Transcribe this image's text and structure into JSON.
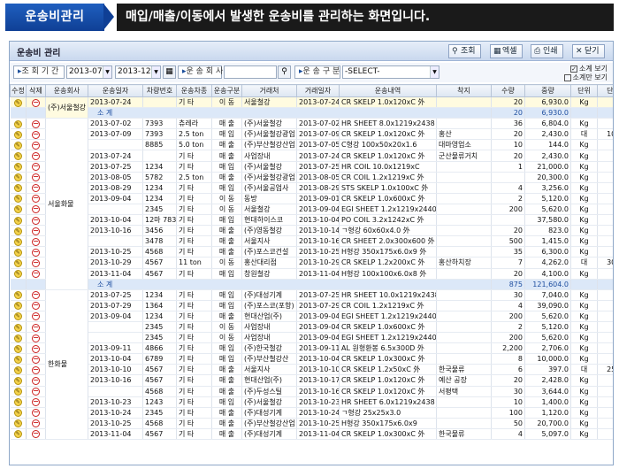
{
  "banner": {
    "title": "운송비관리",
    "description": "매입/매출/이동에서 발생한 운송비를 관리하는 화면입니다."
  },
  "window": {
    "title": "운송비 관리",
    "toolbar": {
      "search_label": "조회",
      "excel_label": "엑셀",
      "print_label": "인쇄",
      "close_label": "닫기"
    }
  },
  "filter": {
    "period_label": "조 회 기 간",
    "date_from": "2013-07-01",
    "date_to": "2013-12-31",
    "company_label": "운 송 회 사",
    "company_value": "",
    "type_label": "운 송 구 분",
    "type_value": "-SELECT-",
    "subtotal_check_label": "소계 보기",
    "subtotal_checked": true,
    "subtotal_only_label": "소계만 보기",
    "subtotal_only_checked": false
  },
  "columns": [
    "수정",
    "삭제",
    "운송회사",
    "운송일자",
    "차량번호",
    "운송차종",
    "운송구분",
    "거래처",
    "거래일자",
    "운송내역",
    "착지",
    "수량",
    "중량",
    "단위",
    "단가"
  ],
  "groups": [
    {
      "company": "(주)서울철강",
      "rows": [
        {
          "date": "2013-07-24",
          "vehicle": "",
          "car_type": "기 타",
          "kind": "이 동",
          "customer": "서울철강",
          "tx_date": "2013-07-24",
          "detail": "CR SKELP 1.0x120xC 外",
          "dest": "",
          "qty": "20",
          "weight": "6,930.0",
          "unit": "Kg",
          "price": "",
          "selected": true
        }
      ],
      "subtotal": {
        "label": "소 계",
        "qty": "20",
        "weight": "6,930.0"
      }
    },
    {
      "company": "서울화물",
      "rows": [
        {
          "date": "2013-07-02",
          "vehicle": "7393",
          "car_type": "츄레라",
          "kind": "매 출",
          "customer": "(주)서울철강",
          "tx_date": "2013-07-02",
          "detail": "HR SHEET 8.0x1219x2438 外",
          "dest": "",
          "qty": "36",
          "weight": "6,804.0",
          "unit": "Kg",
          "price": ""
        },
        {
          "date": "2013-07-09",
          "vehicle": "7393",
          "car_type": "2.5 ton",
          "kind": "매 입",
          "customer": "(주)서울철강광업",
          "tx_date": "2013-07-09",
          "detail": "CR SKELP 1.0x120xC 外",
          "dest": "홍산",
          "qty": "20",
          "weight": "2,430.0",
          "unit": "대",
          "price": "100,0"
        },
        {
          "date": "",
          "vehicle": "8885",
          "car_type": "5.0 ton",
          "kind": "매 출",
          "customer": "(주)부산철강산업",
          "tx_date": "2013-07-05",
          "detail": "C형강 100x50x20x1.6",
          "dest": "대마영업소",
          "qty": "10",
          "weight": "144.0",
          "unit": "Kg",
          "price": ""
        },
        {
          "date": "2013-07-24",
          "vehicle": "",
          "car_type": "기 타",
          "kind": "매 출",
          "customer": "사업장내",
          "tx_date": "2013-07-24",
          "detail": "CR SKELP 1.0x120xC 外",
          "dest": "군산물류거치",
          "qty": "20",
          "weight": "2,430.0",
          "unit": "Kg",
          "price": ""
        },
        {
          "date": "2013-07-25",
          "vehicle": "1234",
          "car_type": "기 타",
          "kind": "매 입",
          "customer": "(주)서울철강",
          "tx_date": "2013-07-25",
          "detail": "HR COIL 10.0x1219xC",
          "dest": "",
          "qty": "1",
          "weight": "21,000.0",
          "unit": "Kg",
          "price": ""
        },
        {
          "date": "2013-08-05",
          "vehicle": "5782",
          "car_type": "2.5 ton",
          "kind": "매 출",
          "customer": "(주)서울철강광업",
          "tx_date": "2013-08-05",
          "detail": "CR COIL 1.2x1219xC 外",
          "dest": "",
          "qty": "",
          "weight": "20,300.0",
          "unit": "Kg",
          "price": ""
        },
        {
          "date": "2013-08-29",
          "vehicle": "1234",
          "car_type": "기 타",
          "kind": "매 입",
          "customer": "(주)서울공업사",
          "tx_date": "2013-08-29",
          "detail": "STS SKELP 1.0x100xC 外",
          "dest": "",
          "qty": "4",
          "weight": "3,256.0",
          "unit": "Kg",
          "price": ""
        },
        {
          "date": "2013-09-04",
          "vehicle": "1234",
          "car_type": "기 타",
          "kind": "이 동",
          "customer": "동방",
          "tx_date": "2013-09-01",
          "detail": "CR SKELP 1.0x600xC 外",
          "dest": "",
          "qty": "2",
          "weight": "5,120.0",
          "unit": "Kg",
          "price": ""
        },
        {
          "date": "",
          "vehicle": "2345",
          "car_type": "기 타",
          "kind": "이 동",
          "customer": "서울철강",
          "tx_date": "2013-09-04",
          "detail": "EGI SHEET 1.2x1219x2440 外",
          "dest": "",
          "qty": "200",
          "weight": "5,620.0",
          "unit": "Kg",
          "price": ""
        },
        {
          "date": "2013-10-04",
          "vehicle": "12마 7834",
          "car_type": "기 타",
          "kind": "매 입",
          "customer": "현대하이스코",
          "tx_date": "2013-10-04",
          "detail": "PO COIL 3.2x1242xC 外",
          "dest": "",
          "qty": "",
          "weight": "37,580.0",
          "unit": "Kg",
          "price": ""
        },
        {
          "date": "2013-10-16",
          "vehicle": "3456",
          "car_type": "기 타",
          "kind": "매 출",
          "customer": "(주)영동철강",
          "tx_date": "2013-10-14",
          "detail": "ㄱ형강 60x60x4.0 外",
          "dest": "",
          "qty": "20",
          "weight": "823.0",
          "unit": "Kg",
          "price": ""
        },
        {
          "date": "",
          "vehicle": "3478",
          "car_type": "기 타",
          "kind": "매 출",
          "customer": "서울지사",
          "tx_date": "2013-10-16",
          "detail": "CR SHEET 2.0x300x600 外",
          "dest": "",
          "qty": "500",
          "weight": "1,415.0",
          "unit": "Kg",
          "price": ""
        },
        {
          "date": "2013-10-25",
          "vehicle": "4568",
          "car_type": "기 타",
          "kind": "매 출",
          "customer": "(주)포스코건설",
          "tx_date": "2013-10-25",
          "detail": "H형강 350x175x6.0x9 外",
          "dest": "",
          "qty": "35",
          "weight": "6,300.0",
          "unit": "Kg",
          "price": ""
        },
        {
          "date": "2013-10-29",
          "vehicle": "4567",
          "car_type": "11 ton",
          "kind": "이 동",
          "customer": "홍산대리점",
          "tx_date": "2013-10-29",
          "detail": "CR SKELP 1.2x200xC 外",
          "dest": "홍산하치장",
          "qty": "7",
          "weight": "4,262.0",
          "unit": "대",
          "price": "300,0"
        },
        {
          "date": "2013-11-04",
          "vehicle": "4567",
          "car_type": "기 타",
          "kind": "매 입",
          "customer": "창원철강",
          "tx_date": "2013-11-04",
          "detail": "H형강 100x100x6.0x8 外",
          "dest": "",
          "qty": "20",
          "weight": "4,100.0",
          "unit": "Kg",
          "price": ""
        }
      ],
      "subtotal": {
        "label": "소 계",
        "qty": "875",
        "weight": "121,604.0"
      }
    },
    {
      "company": "한화물",
      "rows": [
        {
          "date": "2013-07-25",
          "vehicle": "1234",
          "car_type": "기 타",
          "kind": "매 입",
          "customer": "(주)대성기계",
          "tx_date": "2013-07-25",
          "detail": "HR SHEET 10.0x1219x2438 外",
          "dest": "",
          "qty": "30",
          "weight": "7,040.0",
          "unit": "Kg",
          "price": ""
        },
        {
          "date": "2013-07-29",
          "vehicle": "1364",
          "car_type": "기 타",
          "kind": "매 입",
          "customer": "(주)포스코(포항)",
          "tx_date": "2013-07-29",
          "detail": "CR COIL 1.2x1219xC 外",
          "dest": "",
          "qty": "4",
          "weight": "39,090.0",
          "unit": "Kg",
          "price": ""
        },
        {
          "date": "2013-09-04",
          "vehicle": "1234",
          "car_type": "기 타",
          "kind": "매 출",
          "customer": "현대산업(주)",
          "tx_date": "2013-09-04",
          "detail": "EGI SHEET 1.2x1219x2440 外",
          "dest": "",
          "qty": "200",
          "weight": "5,620.0",
          "unit": "Kg",
          "price": ""
        },
        {
          "date": "",
          "vehicle": "2345",
          "car_type": "기 타",
          "kind": "이 동",
          "customer": "사업장내",
          "tx_date": "2013-09-04",
          "detail": "CR SKELP 1.0x600xC 外",
          "dest": "",
          "qty": "2",
          "weight": "5,120.0",
          "unit": "Kg",
          "price": ""
        },
        {
          "date": "",
          "vehicle": "2345",
          "car_type": "기 타",
          "kind": "이 동",
          "customer": "사업장내",
          "tx_date": "2013-09-04",
          "detail": "EGI SHEET 1.2x1219x2440 外",
          "dest": "",
          "qty": "200",
          "weight": "5,620.0",
          "unit": "Kg",
          "price": ""
        },
        {
          "date": "2013-09-11",
          "vehicle": "4866",
          "car_type": "기 타",
          "kind": "매 입",
          "customer": "(주)한국철강",
          "tx_date": "2013-09-11",
          "detail": "AL 원형환봉 6.5x300D 外",
          "dest": "",
          "qty": "2,200",
          "weight": "2,706.0",
          "unit": "Kg",
          "price": ""
        },
        {
          "date": "2013-10-04",
          "vehicle": "6789",
          "car_type": "기 타",
          "kind": "매 입",
          "customer": "(주)부산철강산",
          "tx_date": "2013-10-04",
          "detail": "CR SKELP 1.0x300xC 外",
          "dest": "",
          "qty": "8",
          "weight": "10,000.0",
          "unit": "Kg",
          "price": ""
        },
        {
          "date": "2013-10-10",
          "vehicle": "4567",
          "car_type": "기 타",
          "kind": "매 출",
          "customer": "서울지사",
          "tx_date": "2013-10-10",
          "detail": "CR SKELP 1.2x50xC 外",
          "dest": "한국물류",
          "qty": "6",
          "weight": "397.0",
          "unit": "대",
          "price": "250,0"
        },
        {
          "date": "2013-10-16",
          "vehicle": "4567",
          "car_type": "기 타",
          "kind": "매 출",
          "customer": "현대산업(주)",
          "tx_date": "2013-10-17",
          "detail": "CR SKELP 1.0x120xC 外",
          "dest": "예산 공장",
          "qty": "20",
          "weight": "2,428.0",
          "unit": "Kg",
          "price": ""
        },
        {
          "date": "",
          "vehicle": "4568",
          "car_type": "기 타",
          "kind": "매 출",
          "customer": "(주)두성스틸",
          "tx_date": "2013-10-16",
          "detail": "CR SKELP 1.0x120xC 外",
          "dest": "서평택",
          "qty": "30",
          "weight": "3,644.0",
          "unit": "Kg",
          "price": ""
        },
        {
          "date": "2013-10-23",
          "vehicle": "1243",
          "car_type": "기 타",
          "kind": "매 입",
          "customer": "(주)서울철강",
          "tx_date": "2013-10-23",
          "detail": "HR SHEET 6.0x1219x2438",
          "dest": "",
          "qty": "10",
          "weight": "1,400.0",
          "unit": "Kg",
          "price": ""
        },
        {
          "date": "2013-10-24",
          "vehicle": "2345",
          "car_type": "기 타",
          "kind": "매 출",
          "customer": "(주)대성기계",
          "tx_date": "2013-10-24",
          "detail": "ㄱ형강 25x25x3.0",
          "dest": "",
          "qty": "100",
          "weight": "1,120.0",
          "unit": "Kg",
          "price": ""
        },
        {
          "date": "2013-10-25",
          "vehicle": "4568",
          "car_type": "기 타",
          "kind": "매 출",
          "customer": "(주)부산철강산업",
          "tx_date": "2013-10-25",
          "detail": "H형강 350x175x6.0x9",
          "dest": "",
          "qty": "50",
          "weight": "20,700.0",
          "unit": "Kg",
          "price": ""
        },
        {
          "date": "2013-11-04",
          "vehicle": "4567",
          "car_type": "기 타",
          "kind": "매 출",
          "customer": "(주)대성기계",
          "tx_date": "2013-11-04",
          "detail": "CR SKELP 1.0x300xC 外",
          "dest": "한국물류",
          "qty": "4",
          "weight": "5,097.0",
          "unit": "Kg",
          "price": ""
        }
      ]
    }
  ]
}
